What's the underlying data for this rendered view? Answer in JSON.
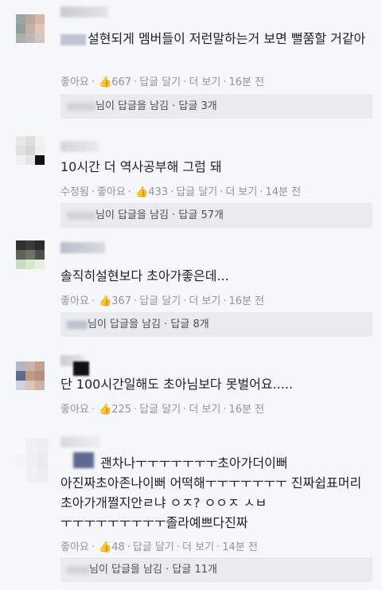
{
  "comments": [
    {
      "text": "설현되게 멤버들이 저런말하는거 보면 뻘쭘할 거같아",
      "meta": {
        "prefix": "",
        "like": "좋아요",
        "count": "667",
        "reply": "답글 달기",
        "more": "더 보기",
        "time": "16분 전"
      },
      "replies": {
        "text": "님이 답글을 남김",
        "count": "답글 3개"
      }
    },
    {
      "text": "10시간 더 역사공부해 그럼 돼",
      "meta": {
        "prefix": "수정됨",
        "like": "좋아요",
        "count": "433",
        "reply": "답글 달기",
        "more": "더 보기",
        "time": "14분 전"
      },
      "replies": {
        "text": "님이 답글을 남김",
        "count": "답글 57개"
      }
    },
    {
      "text": "솔직히설현보다 초아가좋은데...",
      "meta": {
        "prefix": "",
        "like": "좋아요",
        "count": "367",
        "reply": "답글 달기",
        "more": "더 보기",
        "time": "16분 전"
      },
      "replies": {
        "text": "님이 답글을 남김",
        "count": "답글 8개"
      }
    },
    {
      "text": "단 100시간일해도 초아님보다 못벌어요.....",
      "meta": {
        "prefix": "",
        "like": "좋아요",
        "count": "225",
        "reply": "답글 달기",
        "more": "더 보기",
        "time": "16분 전"
      },
      "replies": null
    },
    {
      "text": "괜차나ㅜㅜㅜㅜㅜㅜㅜ초아가더이뻐 아진짜초아존나이뻐 어떡해ㅜㅜㅜㅜㅜㅜㅜ 진짜쉽표머리 초아가개쩔지안ㄹ냐 ㅇㅈ? ㅇㅇㅈ ㅅㅂ ㅜㅜㅜㅜㅜㅜㅜㅜㅜ졸라예쁘다진짜",
      "meta": {
        "prefix": "",
        "like": "좋아요",
        "count": "48",
        "reply": "답글 달기",
        "more": "더 보기",
        "time": "14분 전"
      },
      "replies": {
        "text": "님이 답글을 남김",
        "count": "답글 11개"
      }
    }
  ],
  "icons": {
    "like": "thumbs-up-icon"
  },
  "colors": {
    "link": "#4267b2",
    "meta": "#90949c",
    "reply_bg": "#e9ebee"
  }
}
